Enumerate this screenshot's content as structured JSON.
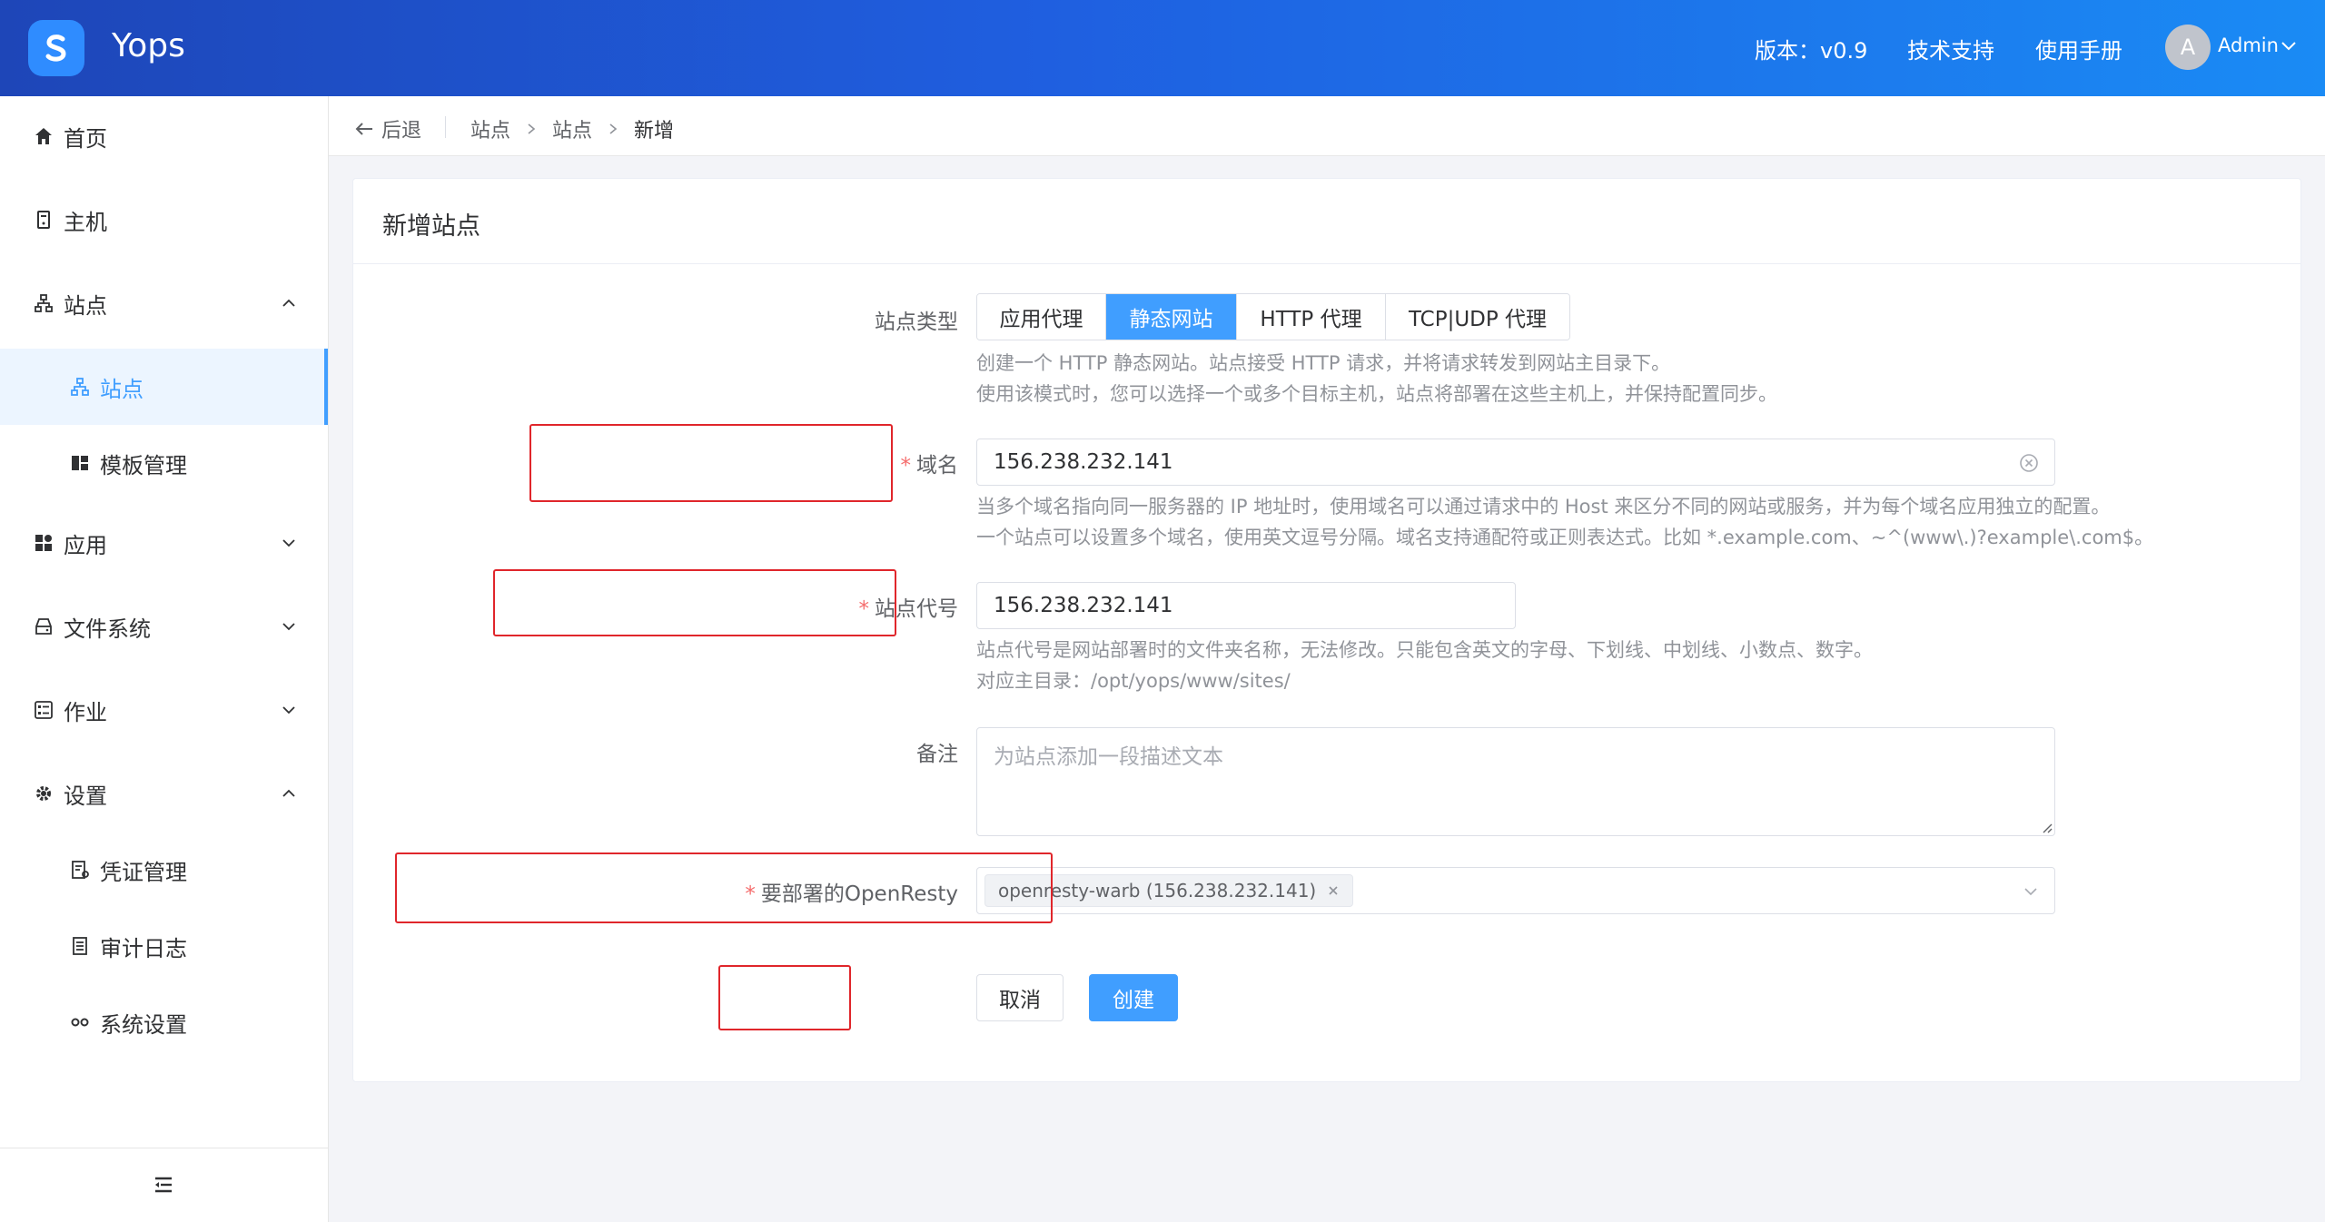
{
  "header": {
    "app_name": "Yops",
    "version": "版本：v0.9",
    "support": "技术支持",
    "manual": "使用手册",
    "avatar_letter": "A",
    "user": "Admin"
  },
  "sidebar": {
    "items": [
      {
        "label": "首页",
        "icon": "home-icon"
      },
      {
        "label": "主机",
        "icon": "server-icon"
      },
      {
        "label": "站点",
        "icon": "sitemap-icon"
      },
      {
        "label": "站点",
        "icon": "sitemap-icon",
        "active": true
      },
      {
        "label": "模板管理",
        "icon": "template-icon"
      },
      {
        "label": "应用",
        "icon": "apps-icon"
      },
      {
        "label": "文件系统",
        "icon": "storage-icon"
      },
      {
        "label": "作业",
        "icon": "jobs-icon"
      },
      {
        "label": "设置",
        "icon": "gear-icon"
      },
      {
        "label": "凭证管理",
        "icon": "credential-icon"
      },
      {
        "label": "审计日志",
        "icon": "log-icon"
      },
      {
        "label": "系统设置",
        "icon": "system-icon"
      }
    ]
  },
  "breadcrumb": {
    "back": "后退",
    "items": [
      "站点",
      "站点",
      "新增"
    ]
  },
  "form": {
    "title": "新增站点",
    "site_type_label": "站点类型",
    "site_types": [
      "应用代理",
      "静态网站",
      "HTTP 代理",
      "TCP|UDP 代理"
    ],
    "site_type_selected": "静态网站",
    "site_type_help_1": "创建一个 HTTP 静态网站。站点接受 HTTP 请求，并将请求转发到网站主目录下。",
    "site_type_help_2": "使用该模式时，您可以选择一个或多个目标主机，站点将部署在这些主机上，并保持配置同步。",
    "domain_label": "域名",
    "domain_value": "156.238.232.141",
    "domain_help_1": "当多个域名指向同一服务器的 IP 地址时，使用域名可以通过请求中的 Host 来区分不同的网站或服务，并为每个域名应用独立的配置。",
    "domain_help_2": "一个站点可以设置多个域名，使用英文逗号分隔。域名支持通配符或正则表达式。比如 *.example.com、~^(www\\.)?example\\.com$。",
    "code_label": "站点代号",
    "code_value": "156.238.232.141",
    "code_help_1": "站点代号是网站部署时的文件夹名称，无法修改。只能包含英文的字母、下划线、中划线、小数点、数字。",
    "code_help_2": "对应主目录：/opt/yops/www/sites/",
    "note_label": "备注",
    "note_placeholder": "为站点添加一段描述文本",
    "openresty_label": "要部署的OpenResty",
    "openresty_tag": "openresty-warb (156.238.232.141)",
    "cancel": "取消",
    "create": "创建"
  }
}
